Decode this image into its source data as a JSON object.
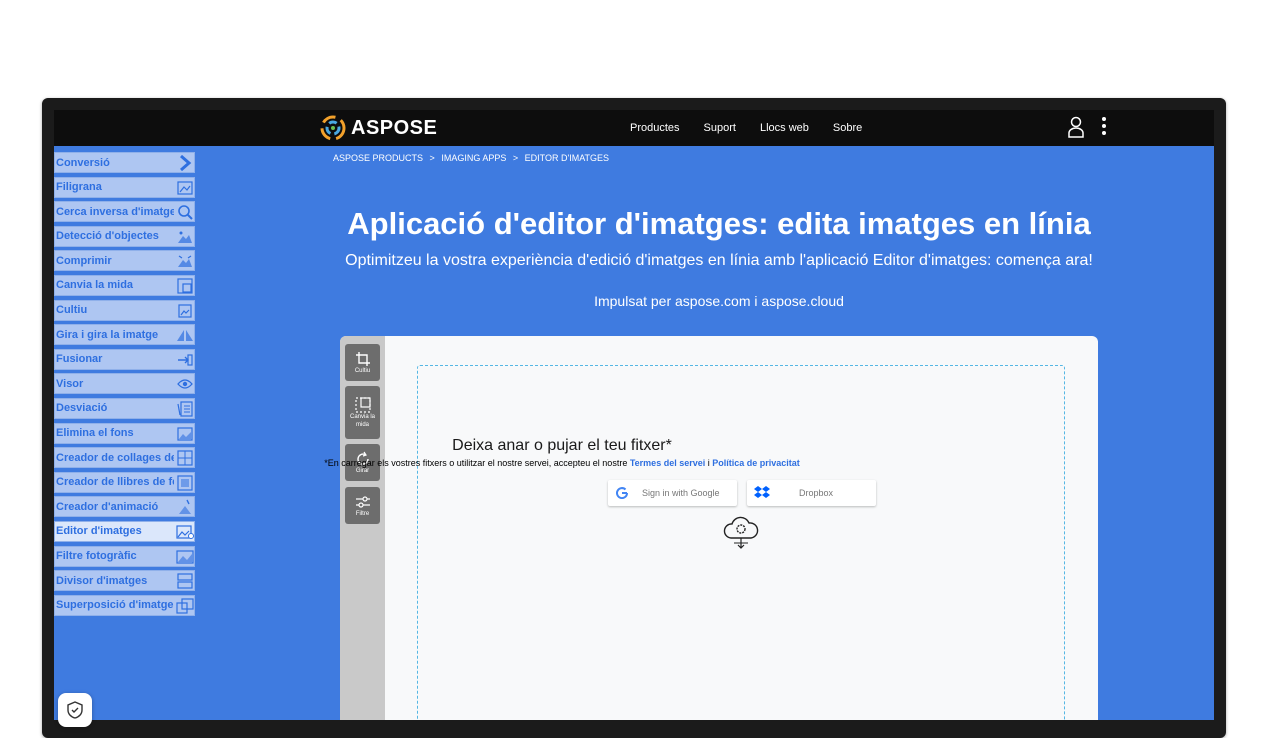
{
  "header": {
    "logo_text": "ASPOSE",
    "nav": [
      "Productes",
      "Suport",
      "Llocs web",
      "Sobre"
    ]
  },
  "breadcrumb": [
    "ASPOSE PRODUCTS",
    ">",
    "IMAGING APPS",
    ">",
    "EDITOR D'IMATGES"
  ],
  "sidebar": {
    "items": [
      {
        "label": "Conversió",
        "icon": "chevron-right-icon"
      },
      {
        "label": "Filigrana",
        "icon": "watermark-icon"
      },
      {
        "label": "Cerca inversa d'imatges",
        "icon": "image-search-icon"
      },
      {
        "label": "Detecció d'objectes",
        "icon": "object-detection-icon"
      },
      {
        "label": "Comprimir",
        "icon": "compress-icon"
      },
      {
        "label": "Canvia la mida",
        "icon": "resize-icon"
      },
      {
        "label": "Cultiu",
        "icon": "crop-icon"
      },
      {
        "label": "Gira i gira la imatge",
        "icon": "rotate-flip-icon"
      },
      {
        "label": "Fusionar",
        "icon": "merge-icon"
      },
      {
        "label": "Visor",
        "icon": "eye-icon"
      },
      {
        "label": "Desviació",
        "icon": "deskew-icon"
      },
      {
        "label": "Elimina el fons",
        "icon": "remove-background-icon"
      },
      {
        "label": "Creador de collages de fotos",
        "icon": "collage-icon"
      },
      {
        "label": "Creador de llibres de fotos",
        "icon": "photo-book-icon"
      },
      {
        "label": "Creador d'animació",
        "icon": "animation-icon"
      },
      {
        "label": "Editor d'imatges",
        "icon": "image-editor-icon",
        "active": true
      },
      {
        "label": "Filtre fotogràfic",
        "icon": "photo-filter-icon"
      },
      {
        "label": "Divisor d'imatges",
        "icon": "image-splitter-icon"
      },
      {
        "label": "Superposició d'imatge",
        "icon": "image-overlay-icon"
      }
    ]
  },
  "hero": {
    "title": "Aplicació d'editor d'imatges: edita imatges en línia",
    "subtitle": "Optimitzeu la vostra experiència d'edició d'imatges en línia amb l'aplicació Editor d'imatges: comença ara!",
    "powered_prefix": "Impulsat per",
    "powered_link1": "aspose.com",
    "powered_mid": "i",
    "powered_link2": "aspose.cloud"
  },
  "tools": [
    {
      "label": "Cultiu",
      "icon": "crop-icon"
    },
    {
      "label": "Canvia la mida",
      "icon": "resize-icon"
    },
    {
      "label": "Girar",
      "icon": "rotate-icon"
    },
    {
      "label": "Filtre",
      "icon": "filter-icon"
    }
  ],
  "dropzone": {
    "title": "Deixa anar o pujar el teu fitxer*",
    "note_prefix": "*En carregar els vostres fitxers o utilitzar el nostre servei, accepteu el nostre",
    "terms": "Termes del servei",
    "note_and": "i",
    "privacy": "Política de privacitat",
    "google_button": "Sign in with Google",
    "dropbox_button": "Dropbox"
  },
  "colors": {
    "page_blue": "#3f7be0",
    "header_bg": "#0d0d0d",
    "link_blue": "#2e6fe0"
  }
}
